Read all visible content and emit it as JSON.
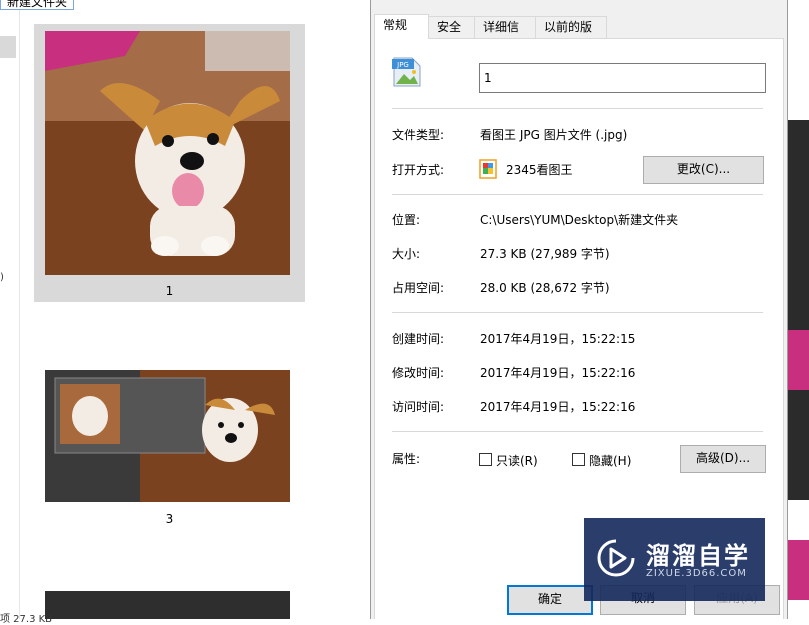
{
  "explorer": {
    "breadcrumb": "新建文件夹",
    "nav_fragment": ")",
    "status_fragment": "项  27.3 KB",
    "tiles": [
      {
        "label": "1"
      },
      {
        "label": "3"
      }
    ]
  },
  "dialog": {
    "tabs": [
      {
        "label": "常规",
        "active": true
      },
      {
        "label": "安全",
        "active": false
      },
      {
        "label": "详细信息",
        "active": false
      },
      {
        "label": "以前的版本",
        "active": false
      }
    ],
    "file_icon": {
      "name": "jpg-file-icon",
      "badge": "JPG"
    },
    "name_value": "1",
    "type_label": "文件类型:",
    "type_value": "看图王 JPG 图片文件 (.jpg)",
    "opens_with_label": "打开方式:",
    "opens_with_value": "2345看图王",
    "change_button": "更改(C)...",
    "location_label": "位置:",
    "location_value": "C:\\Users\\YUM\\Desktop\\新建文件夹",
    "size_label": "大小:",
    "size_value": "27.3 KB (27,989 字节)",
    "disk_label": "占用空间:",
    "disk_value": "28.0 KB (28,672 字节)",
    "created_label": "创建时间:",
    "created_value": "2017年4月19日，15:22:15",
    "modified_label": "修改时间:",
    "modified_value": "2017年4月19日，15:22:16",
    "accessed_label": "访问时间:",
    "accessed_value": "2017年4月19日，15:22:16",
    "attributes_label": "属性:",
    "readonly_label": "只读(R)",
    "readonly_checked": false,
    "hidden_label": "隐藏(H)",
    "hidden_checked": false,
    "advanced_button": "高级(D)...",
    "ok_button": "确定",
    "cancel_button": "取消",
    "apply_button": "应用(A)"
  },
  "watermark": {
    "title": "溜溜自学",
    "subtitle": "ZIXUE.3D66.COM"
  }
}
